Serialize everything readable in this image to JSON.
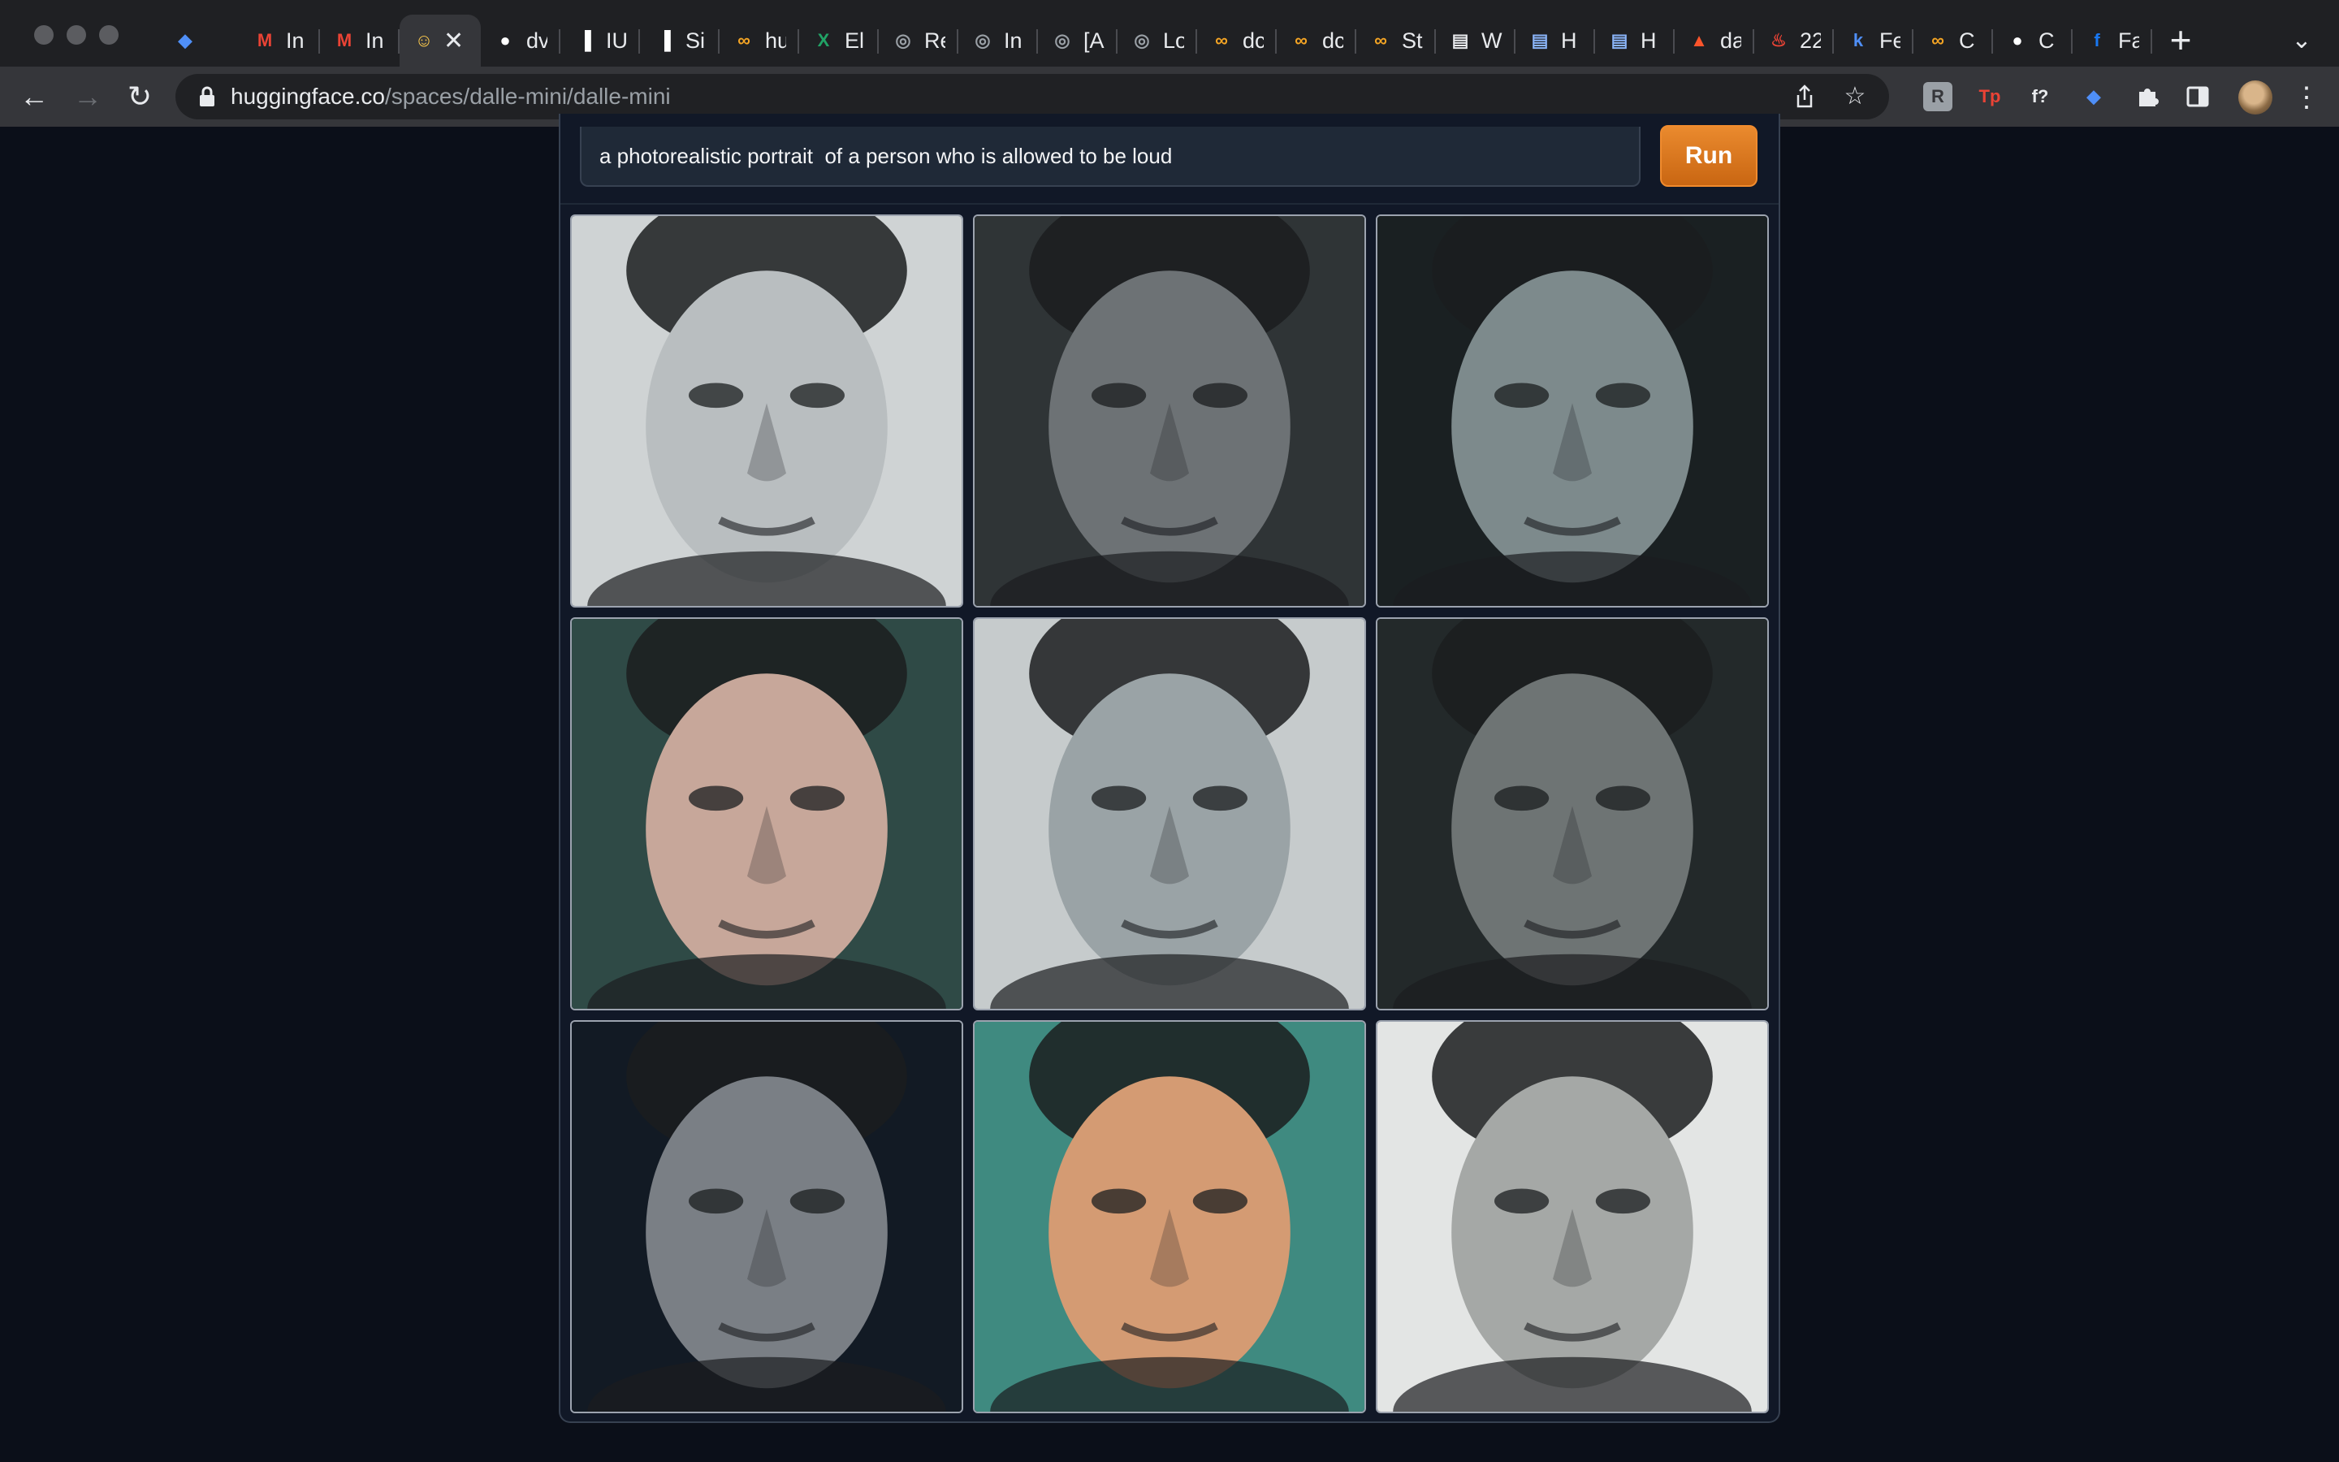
{
  "browser": {
    "tabs": [
      {
        "title": "",
        "icon": "diamond-icon",
        "color": "#4f8ff7"
      },
      {
        "title": "In",
        "icon": "gmail-icon",
        "color": "#ea4335"
      },
      {
        "title": "In",
        "icon": "gmail-icon",
        "color": "#ea4335"
      },
      {
        "title": "",
        "icon": "hugging-face-icon",
        "color": "#ffcc4d",
        "active": true
      },
      {
        "title": "dv",
        "icon": "github-icon",
        "color": "#ffffff"
      },
      {
        "title": "IU",
        "icon": "notion-icon",
        "color": "#ffffff"
      },
      {
        "title": "Si",
        "icon": "notion-icon",
        "color": "#ffffff"
      },
      {
        "title": "hu",
        "icon": "infinity-icon",
        "color": "#f5a524"
      },
      {
        "title": "El",
        "icon": "excel-icon",
        "color": "#21a366"
      },
      {
        "title": "Re",
        "icon": "globe-icon",
        "color": "#9aa0a6"
      },
      {
        "title": "In",
        "icon": "globe-icon",
        "color": "#9aa0a6"
      },
      {
        "title": "[A",
        "icon": "globe-icon",
        "color": "#9aa0a6"
      },
      {
        "title": "Lo",
        "icon": "globe-icon",
        "color": "#9aa0a6"
      },
      {
        "title": "dc",
        "icon": "infinity-icon",
        "color": "#f5a524"
      },
      {
        "title": "dc",
        "icon": "infinity-icon",
        "color": "#f5a524"
      },
      {
        "title": "St",
        "icon": "infinity-icon",
        "color": "#f5a524"
      },
      {
        "title": "W",
        "icon": "document-icon",
        "color": "#e8eaed"
      },
      {
        "title": "H",
        "icon": "document-icon",
        "color": "#8ab4f8"
      },
      {
        "title": "H",
        "icon": "document-icon",
        "color": "#8ab4f8"
      },
      {
        "title": "da",
        "icon": "brave-icon",
        "color": "#fb542b"
      },
      {
        "title": "22",
        "icon": "flame-icon",
        "color": "#ea4335"
      },
      {
        "title": "Fe",
        "icon": "k-icon",
        "color": "#4f8ff7"
      },
      {
        "title": "C",
        "icon": "infinity-icon",
        "color": "#f5a524"
      },
      {
        "title": "C",
        "icon": "github-icon",
        "color": "#ffffff"
      },
      {
        "title": "Fa",
        "icon": "facebook-icon",
        "color": "#1877f2"
      }
    ],
    "url_host": "huggingface.co",
    "url_path": "/spaces/dalle-mini/dalle-mini",
    "extensions": [
      {
        "icon": "readwise-icon",
        "label": "R",
        "color": "#9aa0a6"
      },
      {
        "icon": "tp-icon",
        "label": "Tp",
        "color": "#ea4335"
      },
      {
        "icon": "formula-icon",
        "label": "f?",
        "color": "#e8eaed"
      },
      {
        "icon": "diamond-icon",
        "label": "◆",
        "color": "#4f8ff7"
      }
    ]
  },
  "app": {
    "prompt_value": "a photorealistic portrait  of a person who is allowed to be loud",
    "run_label": "Run",
    "accent_color": "#e07b1f",
    "results": [
      {
        "name": "result-image-1",
        "tone": "#b9bec0",
        "bg": "#cfd3d4"
      },
      {
        "name": "result-image-2",
        "tone": "#6d7275",
        "bg": "#2f3436"
      },
      {
        "name": "result-image-3",
        "tone": "#7d8a8c",
        "bg": "#1a2022"
      },
      {
        "name": "result-image-4",
        "tone": "#c7a79a",
        "bg": "#2f4a46"
      },
      {
        "name": "result-image-5",
        "tone": "#9aa3a6",
        "bg": "#c6cbcc"
      },
      {
        "name": "result-image-6",
        "tone": "#6e7474",
        "bg": "#23292a"
      },
      {
        "name": "result-image-7",
        "tone": "#7a7f85",
        "bg": "#121a24"
      },
      {
        "name": "result-image-8",
        "tone": "#d49b73",
        "bg": "#3f8a80"
      },
      {
        "name": "result-image-9",
        "tone": "#a5a8a6",
        "bg": "#e3e5e4"
      }
    ]
  }
}
